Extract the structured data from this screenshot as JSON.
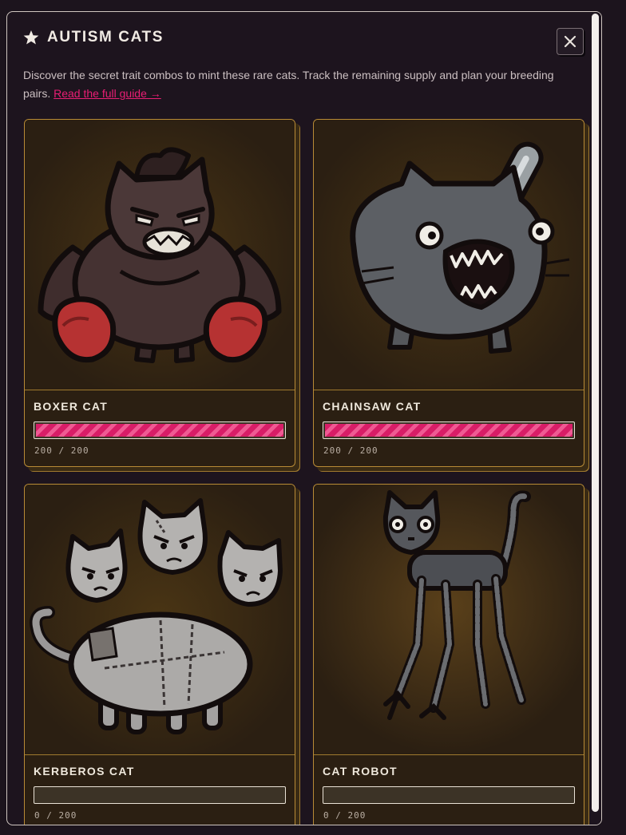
{
  "modal": {
    "title": "AUTISM CATS",
    "title_icon": "star-icon",
    "close_icon": "close-icon",
    "description": "Discover the secret trait combos to mint these rare cats. Track the remaining supply and plan your breeding pairs.",
    "guide_link": "Read the full guide →"
  },
  "colors": {
    "background": "#1d141e",
    "card_background": "#2b1f12",
    "card_border": "#b88b36",
    "accent_pink": "#e91e74"
  },
  "cards": [
    {
      "name": "BOXER CAT",
      "supply": "200 / 200",
      "minted": 200,
      "total": 200,
      "progress": 1.0,
      "art": "boxer-cat-image"
    },
    {
      "name": "CHAINSAW CAT",
      "supply": "200 / 200",
      "minted": 200,
      "total": 200,
      "progress": 1.0,
      "art": "chainsaw-cat-image"
    },
    {
      "name": "KERBEROS CAT",
      "supply": "0 / 200",
      "minted": 0,
      "total": 200,
      "progress": 0.0,
      "art": "kerberos-cat-image"
    },
    {
      "name": "CAT ROBOT",
      "supply": "0 / 200",
      "minted": 0,
      "total": 200,
      "progress": 0.0,
      "art": "cat-robot-image"
    }
  ]
}
